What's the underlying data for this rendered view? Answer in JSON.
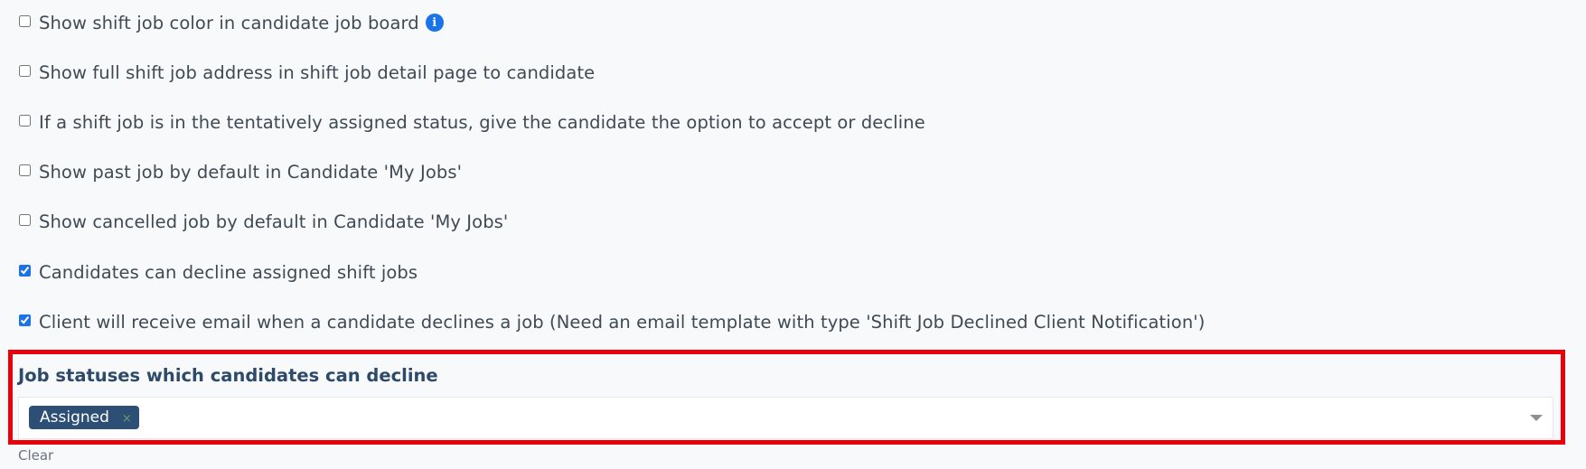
{
  "options": [
    {
      "label": "Show shift job color in candidate job board",
      "checked": false,
      "has_info": true
    },
    {
      "label": "Show full shift job address in shift job detail page to candidate",
      "checked": false
    },
    {
      "label": "If a shift job is in the tentatively assigned status, give the candidate the option to accept or decline",
      "checked": false
    },
    {
      "label": "Show past job by default in Candidate 'My Jobs'",
      "checked": false
    },
    {
      "label": "Show cancelled job by default in Candidate 'My Jobs'",
      "checked": false
    },
    {
      "label": "Candidates can decline assigned shift jobs",
      "checked": true
    },
    {
      "label": "Client will receive email when a candidate declines a job (Need an email template with type 'Shift Job Declined Client Notification')",
      "checked": true
    }
  ],
  "info_icon_glyph": "i",
  "decline_statuses": {
    "label": "Job statuses which candidates can decline",
    "selected": [
      {
        "label": "Assigned",
        "remove_glyph": "×"
      }
    ],
    "clear_label": "Clear"
  },
  "colors": {
    "accent": "#1a73e8",
    "tag_background": "#2d4e75",
    "highlight_border": "#e8000b"
  }
}
